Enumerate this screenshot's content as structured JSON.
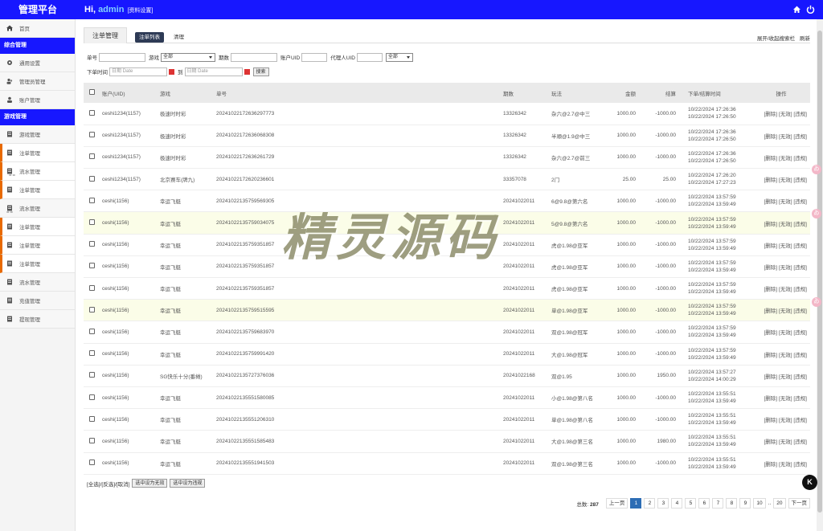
{
  "app": {
    "title": "管理平台",
    "greeting": "Hi,",
    "user": "admin",
    "settings_link": "[资料设置]"
  },
  "sidebar": {
    "home": "首页",
    "group1": "综合管理",
    "group1_items": [
      "通用设置",
      "管理员管理",
      "账户管理"
    ],
    "group2": "游戏管理",
    "group2_items": [
      {
        "label": "游戏管理",
        "active": false,
        "sub": ""
      },
      {
        "label": "注单管理",
        "active": true,
        "sub": ""
      },
      {
        "label": "流水管理",
        "active": true,
        "sub": "=="
      },
      {
        "label": "注单管理",
        "active": true,
        "sub": ""
      },
      {
        "label": "流水管理",
        "active": false,
        "sub": "=="
      },
      {
        "label": "注单管理",
        "active": true,
        "sub": ""
      },
      {
        "label": "注单管理",
        "active": true,
        "sub": ""
      },
      {
        "label": "注单管理",
        "active": true,
        "sub": ""
      },
      {
        "label": "流水管理",
        "active": false,
        "sub": ""
      },
      {
        "label": "充值管理",
        "active": false,
        "sub": ""
      },
      {
        "label": "提现管理",
        "active": false,
        "sub": ""
      }
    ]
  },
  "tabs": {
    "title": "注单管理",
    "sub_active": "注单列表",
    "sub_other": "清理",
    "toggle_search": "展开/收起搜索栏",
    "refresh": "刷新"
  },
  "filters": {
    "order_label": "单号",
    "game_label": "游戏",
    "game_value": "全部",
    "period_label": "期数",
    "account_label": "账户UID",
    "agent_label": "代理人UID",
    "agent_select": "全部",
    "time_label": "下单时间",
    "to_label": "到",
    "date_placeholder": "日期 Date",
    "search_button": "搜索"
  },
  "table": {
    "headers": [
      "账户(UID)",
      "游戏",
      "单号",
      "期数",
      "玩法",
      "金额",
      "结算",
      "下单/结算时间",
      "操作"
    ],
    "rows": [
      {
        "account": "ceshi1234(1157)",
        "game": "极速时时彩",
        "order": "20241022172636297773",
        "period": "13326342",
        "play": "杂六@2.7@中三",
        "amount": "1000.00",
        "settle": "-1000.00",
        "t1": "10/22/2024 17:26:36",
        "t2": "10/22/2024 17:26:50",
        "hl": false
      },
      {
        "account": "ceshi1234(1157)",
        "game": "极速时时彩",
        "order": "20241022172636068308",
        "period": "13326342",
        "play": "半顺@1.9@中三",
        "amount": "1000.00",
        "settle": "-1000.00",
        "t1": "10/22/2024 17:26:36",
        "t2": "10/22/2024 17:26:50",
        "hl": false
      },
      {
        "account": "ceshi1234(1157)",
        "game": "极速时时彩",
        "order": "20241022172636261729",
        "period": "13326342",
        "play": "杂六@2.7@前三",
        "amount": "1000.00",
        "settle": "-1000.00",
        "t1": "10/22/2024 17:26:36",
        "t2": "10/22/2024 17:26:50",
        "hl": false
      },
      {
        "account": "ceshi1234(1157)",
        "game": "北京赛车(牌九)",
        "order": "20241022172620236601",
        "period": "33357078",
        "play": "2门",
        "amount": "25.00",
        "settle": "25.00",
        "t1": "10/22/2024 17:26:20",
        "t2": "10/22/2024 17:27:23",
        "hl": false
      },
      {
        "account": "ceshi(1156)",
        "game": "幸运飞艇",
        "order": "20241022135759569305",
        "period": "20241022011",
        "play": "6@9.8@第六名",
        "amount": "1000.00",
        "settle": "-1000.00",
        "t1": "10/22/2024 13:57:59",
        "t2": "10/22/2024 13:59:49",
        "hl": false
      },
      {
        "account": "ceshi(1156)",
        "game": "幸运飞艇",
        "order": "20241022135759034075",
        "period": "20241022011",
        "play": "5@9.8@第六名",
        "amount": "1000.00",
        "settle": "-1000.00",
        "t1": "10/22/2024 13:57:59",
        "t2": "10/22/2024 13:59:49",
        "hl": true
      },
      {
        "account": "ceshi(1156)",
        "game": "幸运飞艇",
        "order": "20241022135759351857",
        "period": "20241022011",
        "play": "虎@1.98@亚军",
        "amount": "1000.00",
        "settle": "-1000.00",
        "t1": "10/22/2024 13:57:59",
        "t2": "10/22/2024 13:59:49",
        "hl": false
      },
      {
        "account": "ceshi(1156)",
        "game": "幸运飞艇",
        "order": "20241022135759351857",
        "period": "20241022011",
        "play": "虎@1.98@亚军",
        "amount": "1000.00",
        "settle": "-1000.00",
        "t1": "10/22/2024 13:57:59",
        "t2": "10/22/2024 13:59:49",
        "hl": false
      },
      {
        "account": "ceshi(1156)",
        "game": "幸运飞艇",
        "order": "20241022135759351857",
        "period": "20241022011",
        "play": "虎@1.98@亚军",
        "amount": "1000.00",
        "settle": "-1000.00",
        "t1": "10/22/2024 13:57:59",
        "t2": "10/22/2024 13:59:49",
        "hl": false
      },
      {
        "account": "ceshi(1156)",
        "game": "幸运飞艇",
        "order": "20241022135759515595",
        "period": "20241022011",
        "play": "单@1.98@亚军",
        "amount": "1000.00",
        "settle": "-1000.00",
        "t1": "10/22/2024 13:57:59",
        "t2": "10/22/2024 13:59:49",
        "hl": true
      },
      {
        "account": "ceshi(1156)",
        "game": "幸运飞艇",
        "order": "20241022135759683970",
        "period": "20241022011",
        "play": "双@1.98@冠军",
        "amount": "1000.00",
        "settle": "-1000.00",
        "t1": "10/22/2024 13:57:59",
        "t2": "10/22/2024 13:59:49",
        "hl": false
      },
      {
        "account": "ceshi(1156)",
        "game": "幸运飞艇",
        "order": "20241022135759991420",
        "period": "20241022011",
        "play": "大@1.98@冠军",
        "amount": "1000.00",
        "settle": "-1000.00",
        "t1": "10/22/2024 13:57:59",
        "t2": "10/22/2024 13:59:49",
        "hl": false
      },
      {
        "account": "ceshi(1156)",
        "game": "SG快乐十分(番摊)",
        "order": "20241022135727376036",
        "period": "20241022168",
        "play": "双@1.95",
        "amount": "1000.00",
        "settle": "1950.00",
        "t1": "10/22/2024 13:57:27",
        "t2": "10/22/2024 14:00:29",
        "hl": false
      },
      {
        "account": "ceshi(1156)",
        "game": "幸运飞艇",
        "order": "20241022135551580085",
        "period": "20241022011",
        "play": "小@1.98@第八名",
        "amount": "1000.00",
        "settle": "-1000.00",
        "t1": "10/22/2024 13:55:51",
        "t2": "10/22/2024 13:59:49",
        "hl": false
      },
      {
        "account": "ceshi(1156)",
        "game": "幸运飞艇",
        "order": "20241022135551206310",
        "period": "20241022011",
        "play": "单@1.98@第八名",
        "amount": "1000.00",
        "settle": "-1000.00",
        "t1": "10/22/2024 13:55:51",
        "t2": "10/22/2024 13:59:49",
        "hl": false
      },
      {
        "account": "ceshi(1156)",
        "game": "幸运飞艇",
        "order": "20241022135551585483",
        "period": "20241022011",
        "play": "大@1.98@第三名",
        "amount": "1000.00",
        "settle": "1980.00",
        "t1": "10/22/2024 13:55:51",
        "t2": "10/22/2024 13:59:49",
        "hl": false
      },
      {
        "account": "ceshi(1156)",
        "game": "幸运飞艇",
        "order": "20241022135551941503",
        "period": "20241022011",
        "play": "双@1.98@第三名",
        "amount": "1000.00",
        "settle": "-1000.00",
        "t1": "10/22/2024 13:55:51",
        "t2": "10/22/2024 13:59:49",
        "hl": false
      }
    ],
    "ops": [
      "[删除]",
      "[无效]",
      "[违规]"
    ]
  },
  "bulk": {
    "select_text": "[全选]/[反选]/[取消]",
    "invalid_button": "选中设为无效",
    "violation_button": "选中设为违规"
  },
  "pager": {
    "total_label": "总数:",
    "total": "287",
    "prev": "上一页",
    "next": "下一页",
    "pages": [
      "1",
      "2",
      "3",
      "4",
      "5",
      "6",
      "7",
      "8",
      "9",
      "10",
      "..",
      "20"
    ],
    "current": "1"
  },
  "watermark": "精灵源码",
  "floaty": "ゐ",
  "badge": "K",
  "colors": {
    "topbar": "#1717ff",
    "accent": "#e86a00",
    "page_active": "#2d6db5"
  }
}
